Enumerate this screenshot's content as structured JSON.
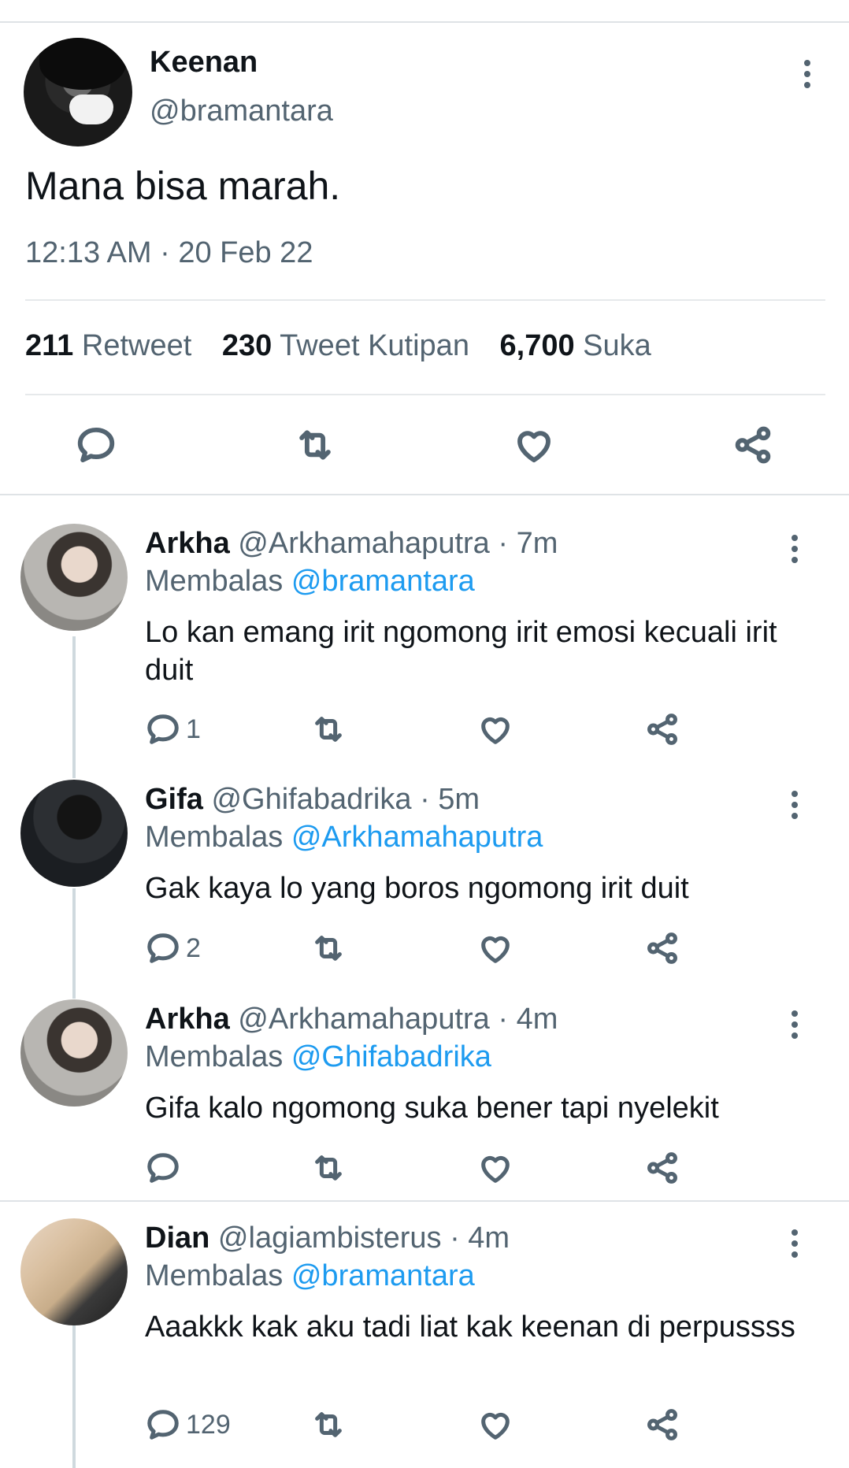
{
  "main_tweet": {
    "name": "Keenan",
    "handle": "@bramantara",
    "text": "Mana bisa marah.",
    "timestamp": "12:13 AM · 20 Feb 22",
    "stats": {
      "retweets": "211",
      "retweets_label": "Retweet",
      "quotes": "230",
      "quotes_label": "Tweet Kutipan",
      "likes": "6,700",
      "likes_label": "Suka"
    },
    "actions": [
      "reply-icon",
      "retweet-icon",
      "like-icon",
      "share-icon"
    ]
  },
  "replies": [
    {
      "name": "Arkha",
      "handle": "@Arkhamahaputra",
      "time": "· 7m",
      "replying_label": "Membalas",
      "replying_to": "@bramantara",
      "text": "Lo kan emang irit ngomong irit emosi kecuali irit duit",
      "reply_count": "1"
    },
    {
      "name": "Gifa",
      "handle": "@Ghifabadrika",
      "time": "· 5m",
      "replying_label": "Membalas",
      "replying_to": "@Arkhamahaputra",
      "text": "Gak kaya lo yang boros ngomong irit duit",
      "reply_count": "2"
    },
    {
      "name": "Arkha",
      "handle": "@Arkhamahaputra",
      "time": "· 4m",
      "replying_label": "Membalas",
      "replying_to": "@Ghifabadrika",
      "text": "Gifa kalo ngomong suka bener tapi nyelekit",
      "reply_count": ""
    },
    {
      "name": "Dian",
      "handle": "@lagiambisterus",
      "time": "· 4m",
      "replying_label": "Membalas",
      "replying_to": "@bramantara",
      "text": "Aaakkk kak aku tadi liat kak keenan di perpussss",
      "reply_count": "129"
    }
  ],
  "colors": {
    "accent": "#1d9bf0",
    "muted": "#536471",
    "text": "#0f1419",
    "rule": "#dfe3e6"
  }
}
